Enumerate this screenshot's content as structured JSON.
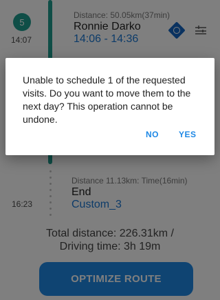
{
  "route": {
    "stop1": {
      "badge": "5",
      "time": "14:07",
      "distance": "Distance: 50.05km(37min)",
      "name": "Ronnie Darko",
      "window": "14:06 - 14:36"
    },
    "end": {
      "time": "16:23",
      "distance": "Distance 11.13km:  Time(16min)",
      "name": "End",
      "location": "Custom_3"
    }
  },
  "summary": {
    "total_distance": "Total distance: 226.31km /",
    "driving_time": "Driving time: 3h 19m"
  },
  "optimize_button": {
    "label": "OPTIMIZE ROUTE"
  },
  "dialog": {
    "message": "Unable to schedule 1 of the requested visits. Do you want to move them to the next day? This operation cannot be undone.",
    "no_label": "NO",
    "yes_label": "YES"
  },
  "icons": [
    "location-pin-icon",
    "filter-icon"
  ],
  "colors": {
    "teal": "#1f9c8f",
    "primary_blue": "#1e88e5",
    "link_blue": "#1976d2"
  }
}
